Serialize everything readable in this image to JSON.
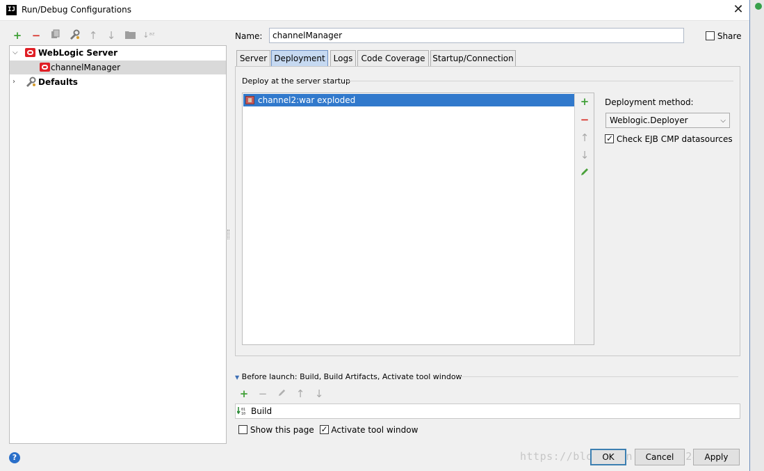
{
  "window": {
    "title": "Run/Debug Configurations",
    "app_icon": "IJ"
  },
  "toolbar": {
    "icons": [
      "add-icon",
      "remove-icon",
      "copy-icon",
      "edit-defaults-icon",
      "move-up-icon",
      "move-down-icon",
      "folder-icon",
      "sort-icon"
    ]
  },
  "tree": {
    "group": "WebLogic Server",
    "item": "channelManager",
    "defaults": "Defaults"
  },
  "form": {
    "name_label": "Name:",
    "name_value": "channelManager",
    "share_label": "Share",
    "share_checked": false
  },
  "tabs": [
    "Server",
    "Deployment",
    "Logs",
    "Code Coverage",
    "Startup/Connection"
  ],
  "active_tab": "Deployment",
  "deployment": {
    "section_title": "Deploy at the server startup",
    "items": [
      "channel2:war exploded"
    ],
    "method_label": "Deployment method:",
    "method_value": "Weblogic.Deployer",
    "ejb_label": "Check EJB CMP datasources",
    "ejb_checked": true
  },
  "before_launch": {
    "title": "Before launch: Build, Build Artifacts, Activate tool window",
    "tasks": [
      "Build"
    ],
    "show_page_label": "Show this page",
    "show_page_checked": false,
    "activate_label": "Activate tool window",
    "activate_checked": true
  },
  "buttons": {
    "ok": "OK",
    "cancel": "Cancel",
    "apply": "Apply"
  },
  "watermark": "https://blog.csdn.net/u012898437",
  "colors": {
    "selection": "#3179cc",
    "add": "#3f9f36",
    "remove": "#d8332b",
    "oracle": "#e01f26"
  }
}
